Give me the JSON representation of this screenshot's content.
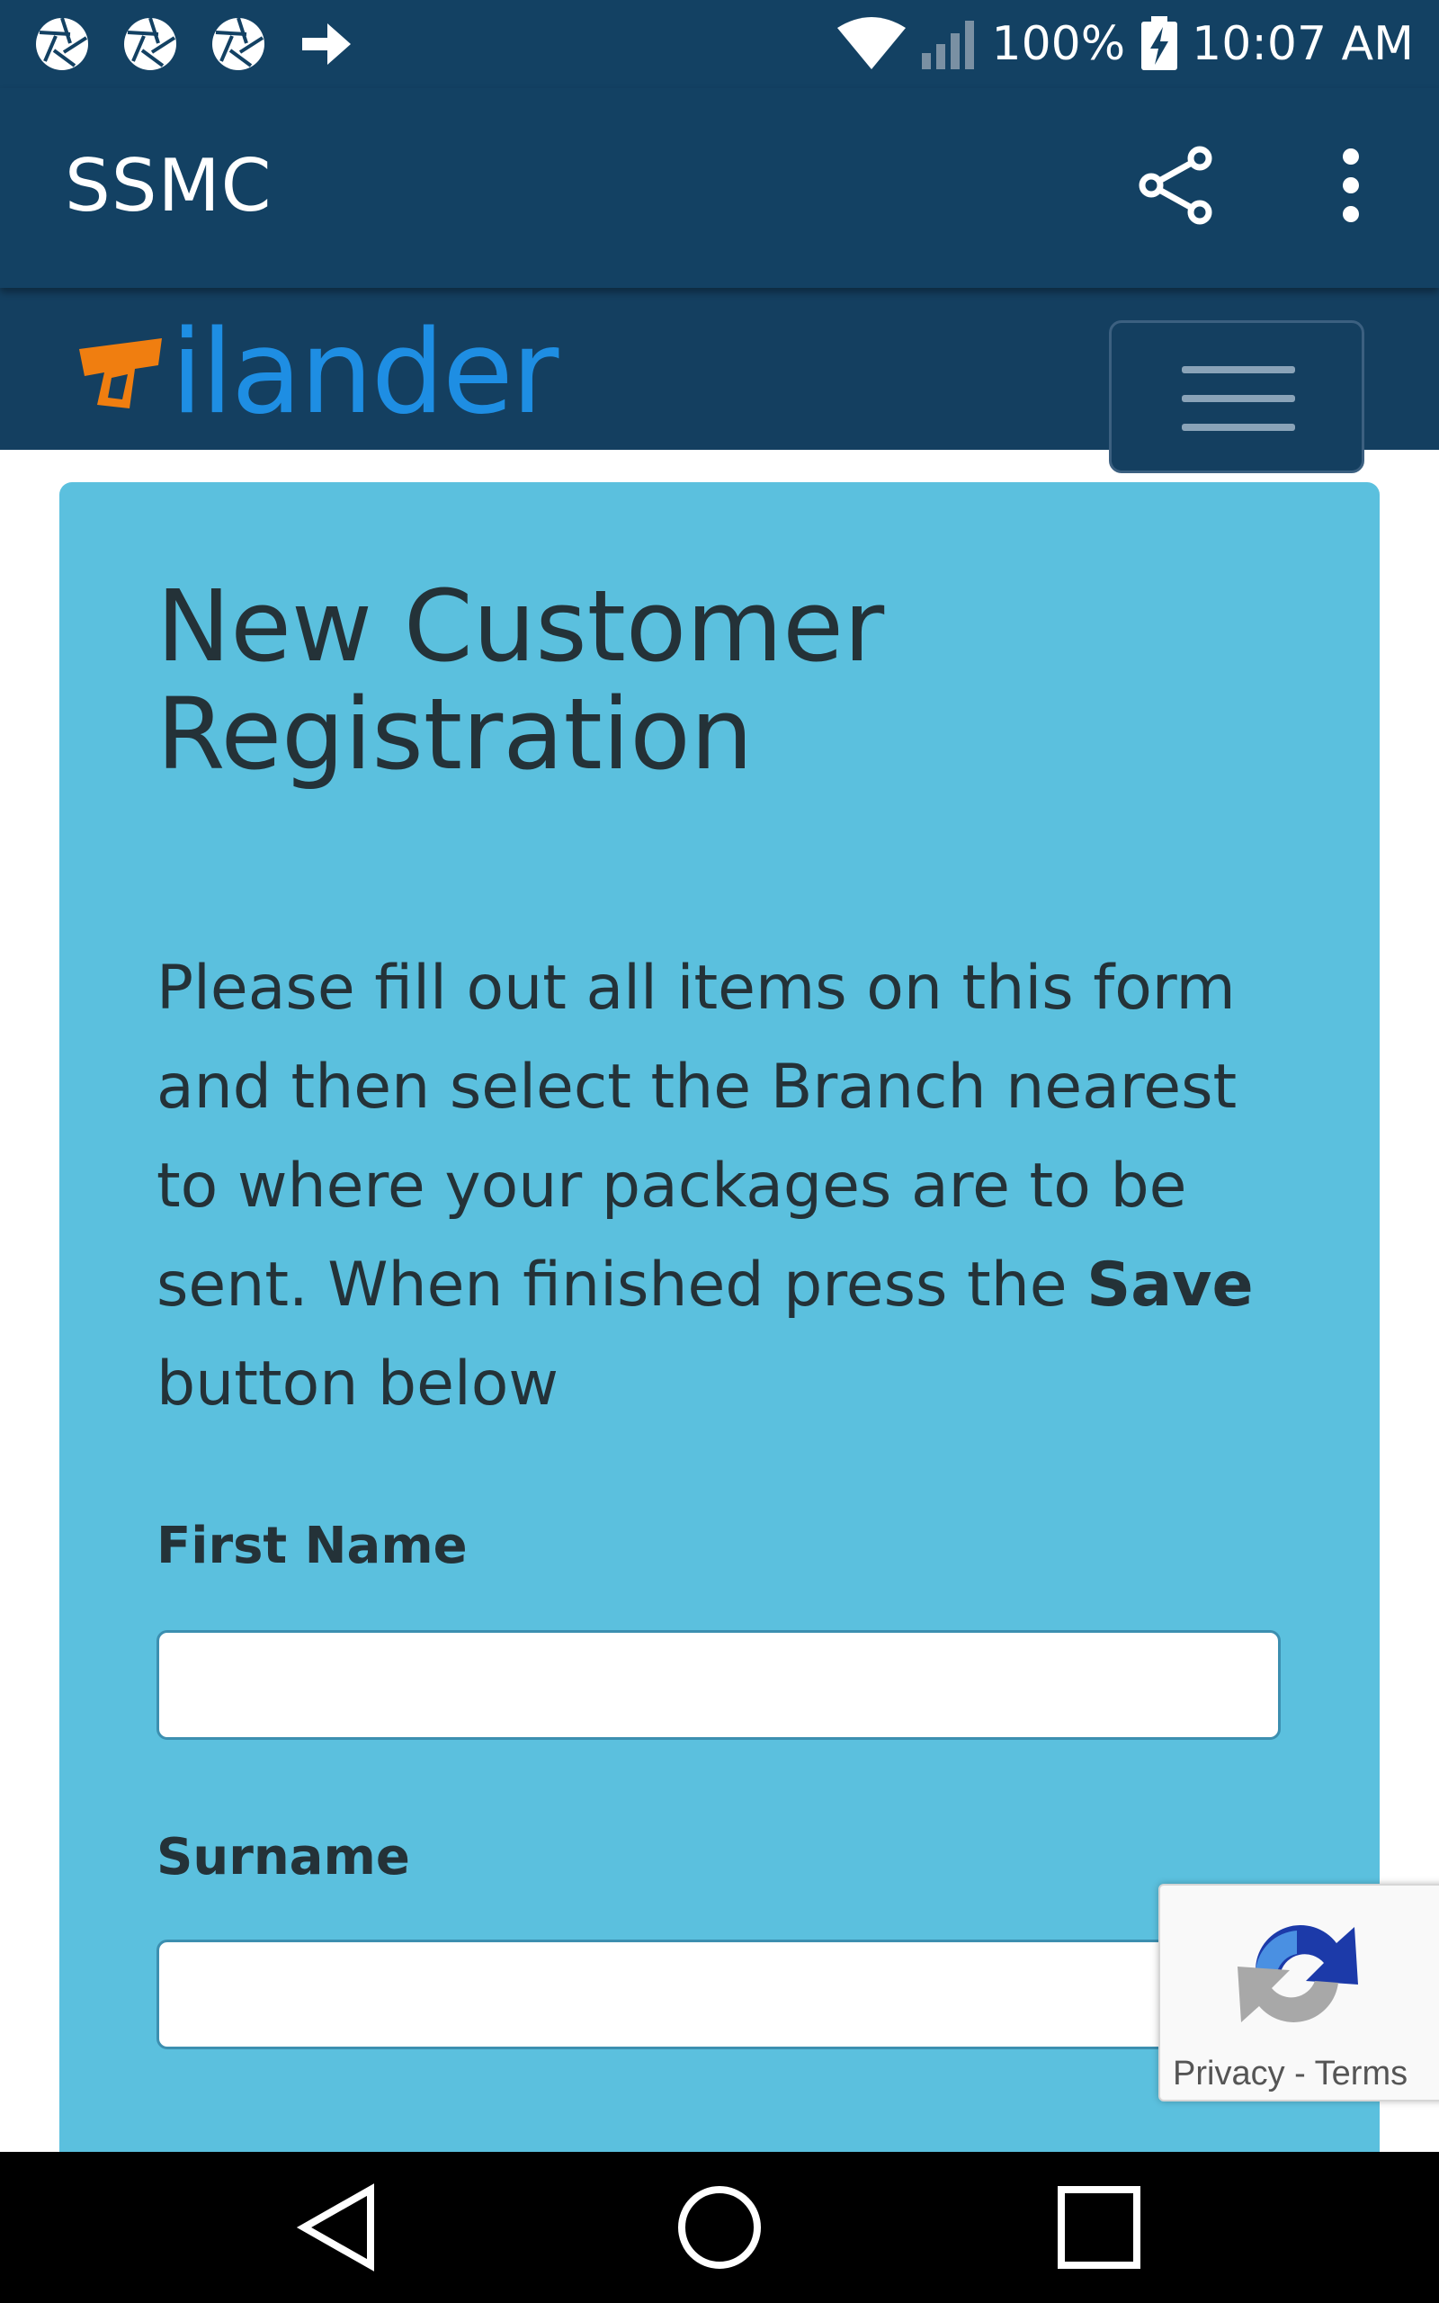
{
  "status_bar": {
    "battery": "100%",
    "time": "10:07 AM",
    "left_icons": [
      "aperture-icon",
      "aperture-icon",
      "aperture-icon",
      "arrow-right-icon"
    ],
    "right_icons": [
      "wifi-icon",
      "signal-icon",
      "battery-charging-icon"
    ]
  },
  "app_bar": {
    "title": "SSMC",
    "actions": [
      "share-icon",
      "more-vert-icon"
    ]
  },
  "site_header": {
    "logo_text": "ilander",
    "menu_icon": "hamburger-icon"
  },
  "form": {
    "title_line1": "New Customer",
    "title_line2": "Registration",
    "instructions_before": "Please fill out all items on this form and then select the Branch nearest to where your packages are to be sent. When finished press the ",
    "instructions_bold": "Save",
    "instructions_after": " button below",
    "fields": [
      {
        "label": "First Name",
        "value": "",
        "placeholder": ""
      },
      {
        "label": "Surname",
        "value": "",
        "placeholder": ""
      }
    ]
  },
  "recaptcha": {
    "privacy": "Privacy",
    "separator": " - ",
    "terms": "Terms"
  },
  "nav_bar": {
    "buttons": [
      "back-icon",
      "home-icon",
      "recents-icon"
    ]
  },
  "colors": {
    "status_bar": "#134163",
    "card_background": "#5bc0de",
    "logo_blue": "#1e8ee3",
    "logo_orange": "#f07e10",
    "text_dark": "#243238"
  }
}
